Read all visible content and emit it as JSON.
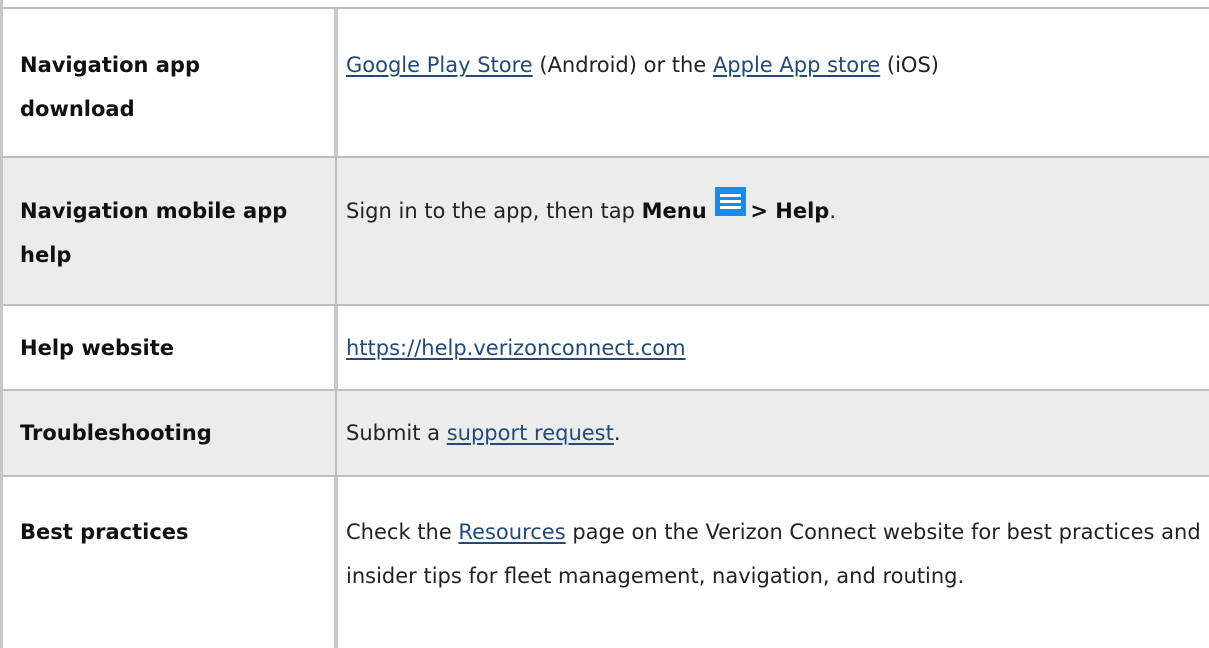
{
  "rows": [
    {
      "label": "Navigation app download",
      "value": {
        "link1": "Google Play Store",
        "text1": " (Android) or the ",
        "link2": "Apple App store",
        "text2": " (iOS)"
      }
    },
    {
      "label": "Navigation mobile app help",
      "value": {
        "text1": "Sign in to the app, then tap ",
        "menu_bold": "Menu",
        "icon": "hamburger-menu-icon",
        "help_bold": "> Help",
        "text2": "."
      }
    },
    {
      "label": "Help website",
      "value": {
        "link1": "https://help.verizonconnect.com"
      }
    },
    {
      "label": "Troubleshooting",
      "value": {
        "text1": "Submit a ",
        "link1": "support request",
        "text2": "."
      }
    },
    {
      "label": "Best practices",
      "value": {
        "text1": "Check the ",
        "link1": "Resources",
        "text2": " page on the Verizon Connect website for best practices and insider tips for fleet management, navigation, and routing."
      }
    }
  ],
  "colors": {
    "link": "#1f4a7a",
    "shaded_row": "#ececec",
    "menu_icon": "#1b8be6"
  }
}
